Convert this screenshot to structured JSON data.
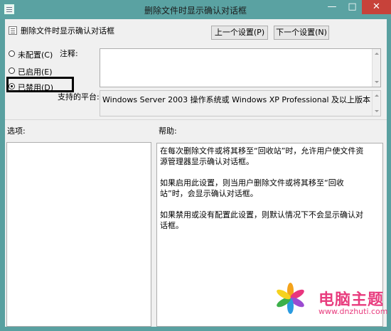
{
  "window": {
    "title": "删除文件时显示确认对话框",
    "controls": {
      "minimize": "—",
      "maximize": "□",
      "close": "✕"
    }
  },
  "header": {
    "setting_name": "删除文件时显示确认对话框",
    "prev_button": "上一个设置(P)",
    "next_button": "下一个设置(N)"
  },
  "state": {
    "options": [
      {
        "label": "未配置(C)",
        "selected": false
      },
      {
        "label": "已启用(E)",
        "selected": false
      },
      {
        "label": "已禁用(D)",
        "selected": true
      }
    ]
  },
  "comment": {
    "label": "注释:",
    "value": ""
  },
  "platform": {
    "label": "支持的平台:",
    "value": "Windows Server 2003 操作系统或 Windows XP Professional 及以上版本"
  },
  "options_panel": {
    "label": "选项:"
  },
  "help_panel": {
    "label": "帮助:",
    "paragraphs": [
      "在每次删除文件或将其移至“回收站”时，允许用户使文件资源管理器显示确认对话框。",
      "如果启用此设置，则当用户删除文件或将其移至“回收站”时，会显示确认对话框。",
      "如果禁用或没有配置此设置，则默认情况下不会显示确认对话框。"
    ]
  },
  "watermark": {
    "text": "电脑主题",
    "url": "www.dnzhuti.com"
  },
  "colors": {
    "title_bar": "#5aa2a2",
    "close_button": "#c7423a",
    "dialog_bg": "#f0f0f0",
    "watermark": "#e83c7e"
  }
}
